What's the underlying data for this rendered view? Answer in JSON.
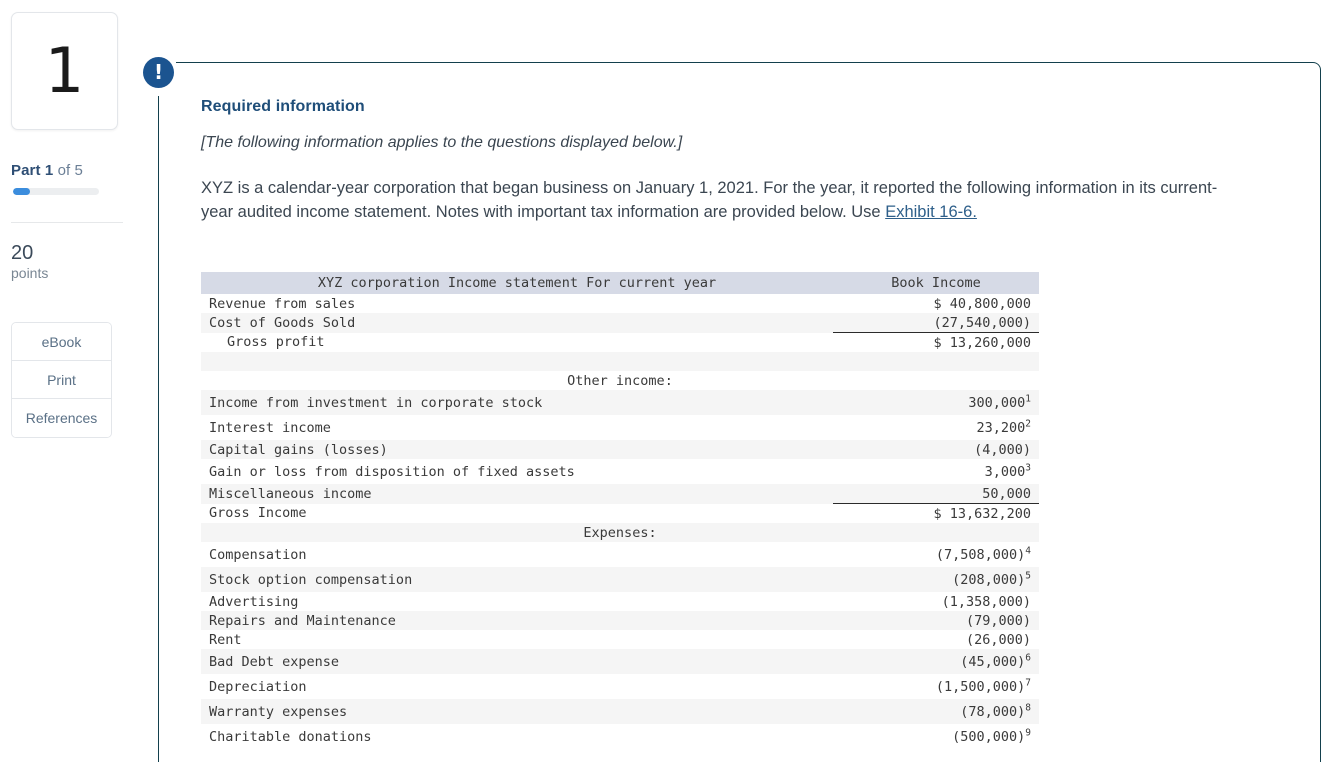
{
  "sidebar": {
    "question_number": "1",
    "part_strong": "Part 1",
    "part_light": "of 5",
    "progress_percent": 20,
    "points_value": "20",
    "points_label": "points",
    "buttons": [
      {
        "label": "eBook",
        "name": "ebook-button"
      },
      {
        "label": "Print",
        "name": "print-button"
      },
      {
        "label": "References",
        "name": "references-button"
      }
    ]
  },
  "alert": {
    "icon": "exclamation-icon",
    "glyph": "!"
  },
  "content": {
    "required_title": "Required information",
    "intro_italic": "[The following information applies to the questions displayed below.]",
    "body_text_before_link": "XYZ is a calendar-year corporation that began business on January 1, 2021. For the year, it reported the following information in its current-year audited income statement. Notes with important tax information are provided below. Use ",
    "exhibit_link": "Exhibit 16-6."
  },
  "statement": {
    "title": "XYZ corporation Income statement For current year",
    "amount_header": "Book Income",
    "rows": [
      {
        "type": "row",
        "label": "Revenue from sales",
        "indent": 0,
        "amount": "$ 40,800,000",
        "note": "",
        "ruled": false,
        "zebra": false,
        "tall": false
      },
      {
        "type": "row",
        "label": "Cost of Goods Sold",
        "indent": 0,
        "amount": "(27,540,000)",
        "note": "",
        "ruled": true,
        "zebra": true,
        "tall": false
      },
      {
        "type": "row",
        "label": "Gross profit",
        "indent": 1,
        "amount": "$ 13,260,000",
        "note": "",
        "ruled": false,
        "zebra": false,
        "tall": false
      },
      {
        "type": "blank",
        "label": "",
        "indent": 0,
        "amount": "",
        "note": "",
        "ruled": false,
        "zebra": true,
        "tall": false
      },
      {
        "type": "section",
        "label": "Other income:",
        "indent": 0,
        "amount": "",
        "note": "",
        "ruled": false,
        "zebra": false,
        "tall": false
      },
      {
        "type": "row",
        "label": "Income from investment in corporate stock",
        "indent": 0,
        "amount": "300,000",
        "note": "1",
        "ruled": false,
        "zebra": true,
        "tall": true
      },
      {
        "type": "row",
        "label": "Interest income",
        "indent": 0,
        "amount": "23,200",
        "note": "2",
        "ruled": false,
        "zebra": false,
        "tall": true
      },
      {
        "type": "row",
        "label": "Capital gains (losses)",
        "indent": 0,
        "amount": "(4,000)",
        "note": "",
        "ruled": false,
        "zebra": true,
        "tall": false
      },
      {
        "type": "row",
        "label": "Gain or loss from disposition of fixed assets",
        "indent": 0,
        "amount": "3,000",
        "note": "3",
        "ruled": false,
        "zebra": false,
        "tall": true
      },
      {
        "type": "row",
        "label": "Miscellaneous income",
        "indent": 0,
        "amount": "50,000",
        "note": "",
        "ruled": true,
        "zebra": true,
        "tall": false
      },
      {
        "type": "row",
        "label": "Gross Income",
        "indent": 0,
        "amount": "$ 13,632,200",
        "note": "",
        "ruled": false,
        "zebra": false,
        "tall": false
      },
      {
        "type": "section",
        "label": "Expenses:",
        "indent": 0,
        "amount": "",
        "note": "",
        "ruled": false,
        "zebra": true,
        "tall": false
      },
      {
        "type": "row",
        "label": "Compensation",
        "indent": 0,
        "amount": "(7,508,000)",
        "note": "4",
        "ruled": false,
        "zebra": false,
        "tall": true
      },
      {
        "type": "row",
        "label": "Stock option compensation",
        "indent": 0,
        "amount": "(208,000)",
        "note": "5",
        "ruled": false,
        "zebra": true,
        "tall": true
      },
      {
        "type": "row",
        "label": "Advertising",
        "indent": 0,
        "amount": "(1,358,000)",
        "note": "",
        "ruled": false,
        "zebra": false,
        "tall": false
      },
      {
        "type": "row",
        "label": "Repairs and Maintenance",
        "indent": 0,
        "amount": "(79,000)",
        "note": "",
        "ruled": false,
        "zebra": true,
        "tall": false
      },
      {
        "type": "row",
        "label": "Rent",
        "indent": 0,
        "amount": "(26,000)",
        "note": "",
        "ruled": false,
        "zebra": false,
        "tall": false
      },
      {
        "type": "row",
        "label": "Bad Debt expense",
        "indent": 0,
        "amount": "(45,000)",
        "note": "6",
        "ruled": false,
        "zebra": true,
        "tall": true
      },
      {
        "type": "row",
        "label": "Depreciation",
        "indent": 0,
        "amount": "(1,500,000)",
        "note": "7",
        "ruled": false,
        "zebra": false,
        "tall": true
      },
      {
        "type": "row",
        "label": "Warranty expenses",
        "indent": 0,
        "amount": "(78,000)",
        "note": "8",
        "ruled": false,
        "zebra": true,
        "tall": true
      },
      {
        "type": "row",
        "label": "Charitable donations",
        "indent": 0,
        "amount": "(500,000)",
        "note": "9",
        "ruled": false,
        "zebra": false,
        "tall": true
      }
    ]
  },
  "colors": {
    "accent_blue": "#1b5490",
    "progress_blue": "#3b8ddd",
    "link_blue": "#2e5f8a",
    "title_blue": "#1f4e79",
    "table_header_bg": "#d6dae6",
    "zebra_bg": "#f5f5f5",
    "panel_border": "#13404d"
  }
}
